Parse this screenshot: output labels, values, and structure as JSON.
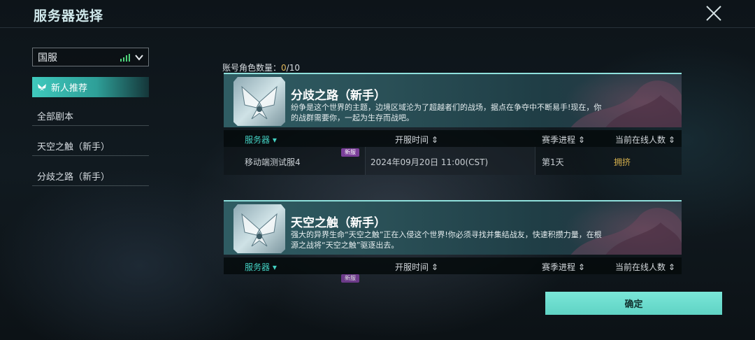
{
  "header": {
    "title": "服务器选择"
  },
  "sidebar": {
    "region": "国服",
    "items": [
      {
        "label": "新人推荐"
      },
      {
        "label": "全部剧本"
      },
      {
        "label": "天空之触（新手）"
      },
      {
        "label": "分歧之路（新手）"
      }
    ]
  },
  "main": {
    "role_count_label": "账号角色数量：",
    "role_count_current": "0",
    "role_count_max": "/10",
    "columns": {
      "server": "服务器",
      "open_time": "开服时间",
      "season": "赛季进程",
      "online": "当前在线人数"
    },
    "cards": [
      {
        "title": "分歧之路（新手）",
        "description": "纷争是这个世界的主题，边境区域沦为了超越者们的战场，据点在争夺中不断易手!现在，你的战群需要你，一起为生存而战吧。",
        "rows": [
          {
            "badge": "新服",
            "server": "移动端测试服4",
            "open_time": "2024年09月20日 11:00(CST)",
            "season": "第1天",
            "status": "拥挤"
          }
        ]
      },
      {
        "title": "天空之触（新手）",
        "description": "强大的异界生命“天空之触”正在入侵这个世界!你必须寻找并集结战友，快速积攒力量，在根源之战将“天空之触”驱逐出去。",
        "rows_partial_badge": "新服"
      }
    ]
  },
  "footer": {
    "confirm": "确定"
  },
  "colors": {
    "accent": "#43d0c2",
    "button": "#6fdccf",
    "busy": "#d6b04d",
    "count": "#e0b75a",
    "badge": "#7b3f9a"
  }
}
